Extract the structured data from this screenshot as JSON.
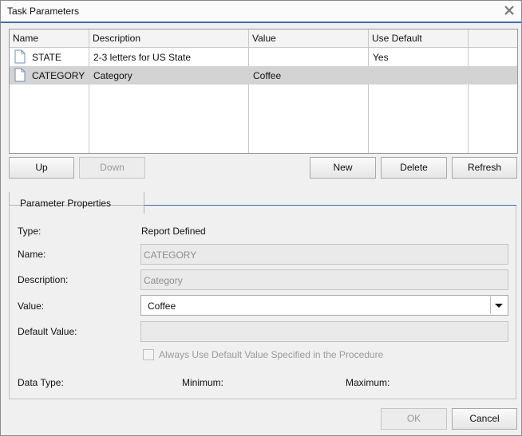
{
  "window": {
    "title": "Task Parameters"
  },
  "grid": {
    "columns": [
      "Name",
      "Description",
      "Value",
      "Use Default"
    ],
    "rows": [
      {
        "name": "STATE",
        "description": "2-3 letters for US State",
        "value": "",
        "use_default": "Yes",
        "selected": false
      },
      {
        "name": "CATEGORY",
        "description": "Category",
        "value": "Coffee",
        "use_default": "",
        "selected": true
      }
    ]
  },
  "buttons": {
    "up": "Up",
    "down": "Down",
    "new": "New",
    "delete": "Delete",
    "refresh": "Refresh",
    "ok": "OK",
    "cancel": "Cancel"
  },
  "properties": {
    "section_title": "Parameter Properties",
    "type_label": "Type:",
    "type_value": "Report Defined",
    "name_label": "Name:",
    "name_value": "CATEGORY",
    "description_label": "Description:",
    "description_value": "Category",
    "value_label": "Value:",
    "value_value": "Coffee",
    "default_value_label": "Default Value:",
    "default_value_value": "",
    "checkbox_label": "Always Use Default Value Specified in the Procedure",
    "checkbox_checked": false,
    "data_type_label": "Data Type:",
    "minimum_label": "Minimum:",
    "maximum_label": "Maximum:"
  },
  "icons": {
    "close": "close-icon",
    "document": "document-icon",
    "dropdown": "chevron-down-icon"
  },
  "colors": {
    "accent": "#3a6fb5",
    "selected_row": "#d3d3d3"
  }
}
